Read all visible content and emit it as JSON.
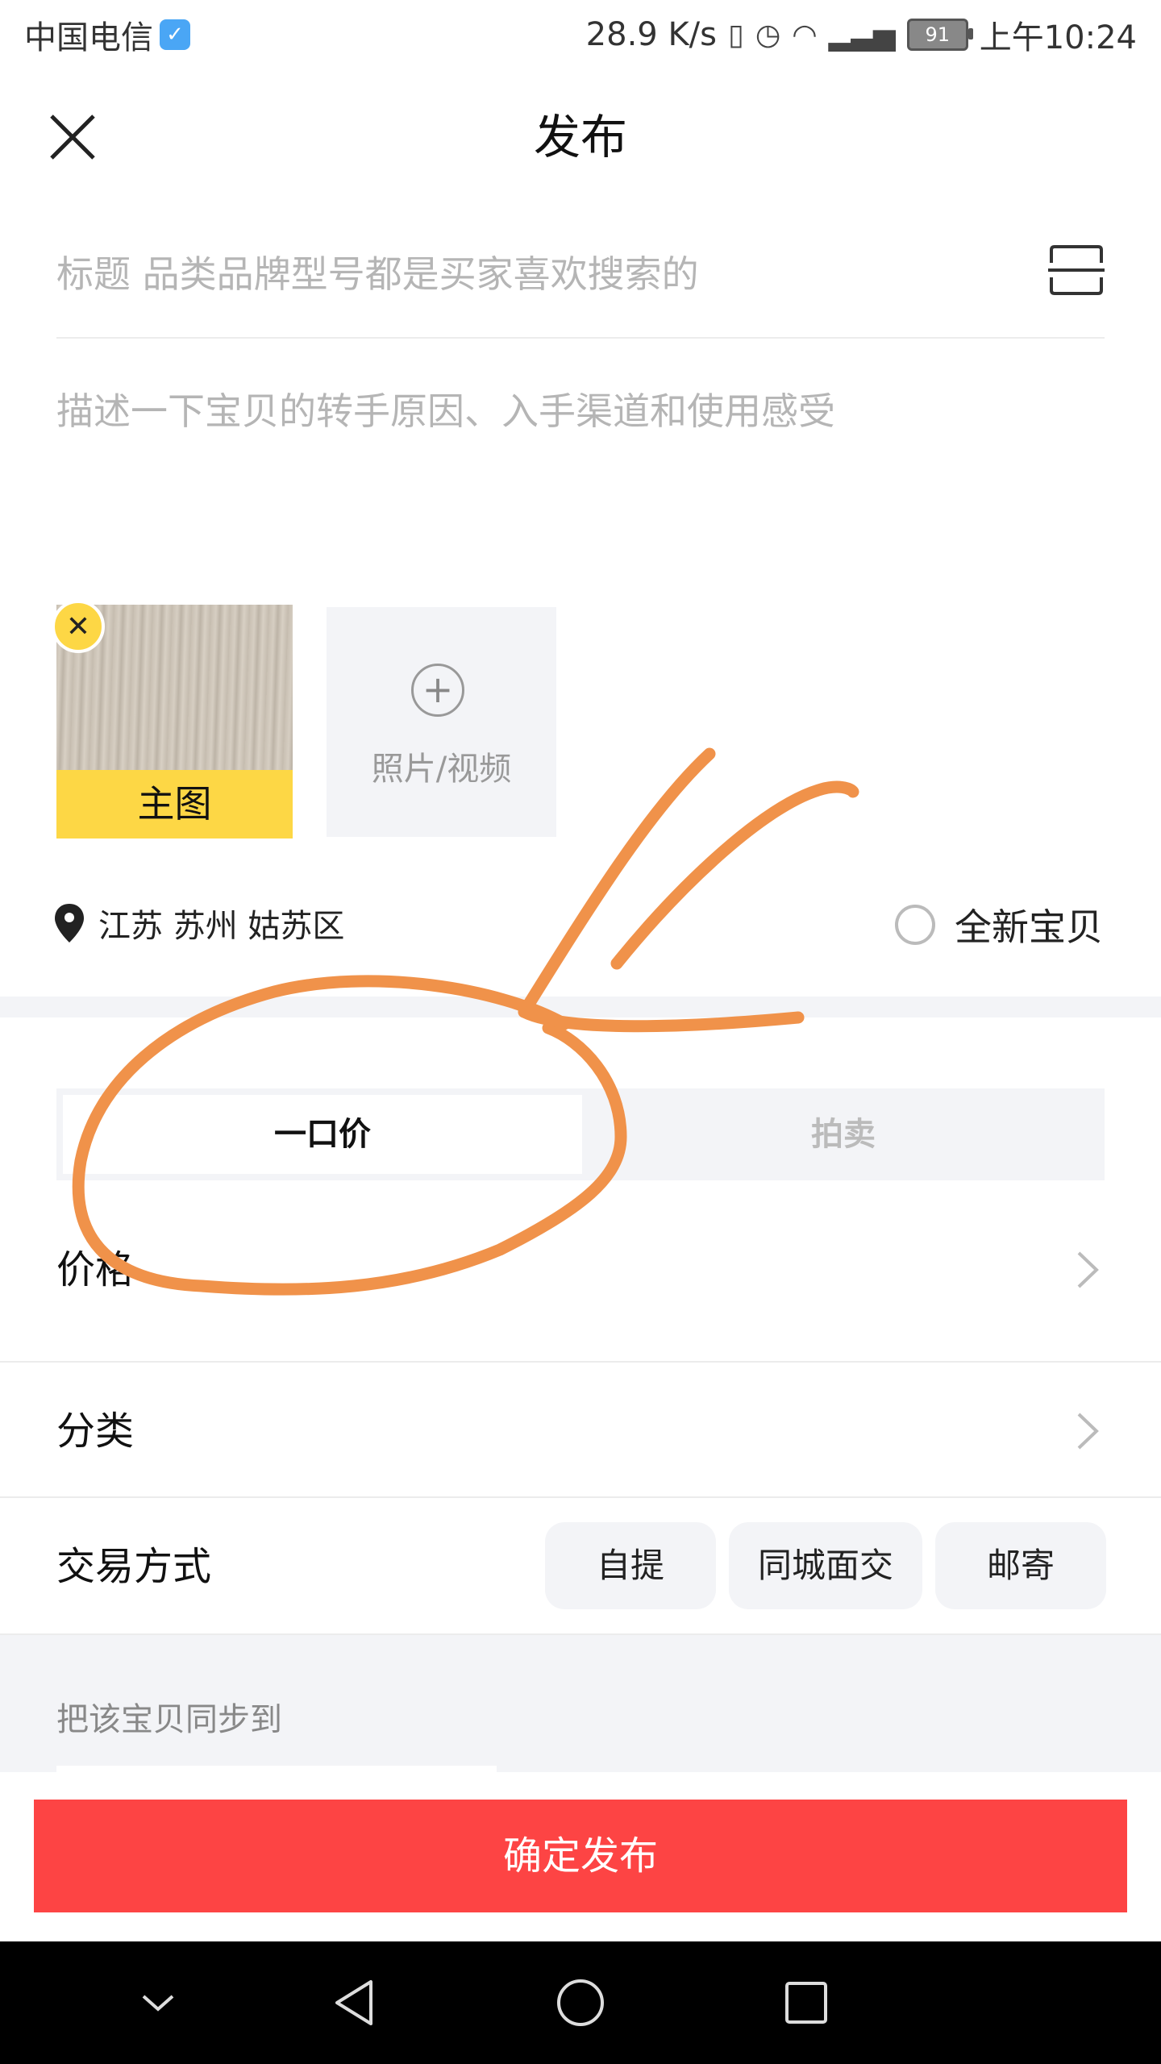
{
  "status_bar": {
    "carrier": "中国电信",
    "speed": "28.9 K/s",
    "battery": "91",
    "time": "上午10:24"
  },
  "header": {
    "title": "发布"
  },
  "form": {
    "title_placeholder": "标题 品类品牌型号都是买家喜欢搜索的",
    "desc_placeholder": "描述一下宝贝的转手原因、入手渠道和使用感受"
  },
  "photos": {
    "main_label": "主图",
    "add_label": "照片/视频"
  },
  "location": {
    "text": "江苏 苏州 姑苏区"
  },
  "new_item_label": "全新宝贝",
  "pricing_tabs": [
    {
      "label": "一口价",
      "selected": true
    },
    {
      "label": "拍卖",
      "selected": false
    }
  ],
  "rows": {
    "price": "价格",
    "category": "分类",
    "trade": "交易方式"
  },
  "trade_options": [
    "自提",
    "同城面交",
    "邮寄"
  ],
  "sync_label": "把该宝贝同步到",
  "confirm_label": "确定发布",
  "colors": {
    "accent_yellow": "#fdd745",
    "confirm_red": "#fd4444",
    "annotation_orange": "#f0924a"
  },
  "icons": [
    "close-icon",
    "scan-icon",
    "location-pin-icon",
    "plus-icon",
    "chevron-right-icon",
    "nav-back-icon",
    "nav-home-icon",
    "nav-recents-icon",
    "nav-collapse-icon"
  ]
}
